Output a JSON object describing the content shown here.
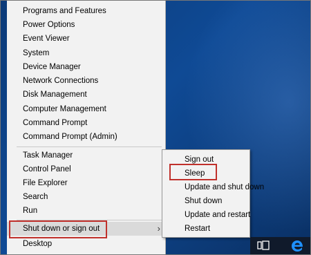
{
  "power_user_menu": {
    "group1": [
      "Programs and Features",
      "Power Options",
      "Event Viewer",
      "System",
      "Device Manager",
      "Network Connections",
      "Disk Management",
      "Computer Management",
      "Command Prompt",
      "Command Prompt (Admin)"
    ],
    "group2": [
      "Task Manager",
      "Control Panel",
      "File Explorer",
      "Search",
      "Run"
    ],
    "shutdown_item": "Shut down or sign out",
    "desktop_item": "Desktop"
  },
  "shutdown_submenu": {
    "items": [
      "Sign out",
      "Sleep",
      "Update and shut down",
      "Shut down",
      "Update and restart",
      "Restart"
    ]
  },
  "highlight_color": "#c0302b",
  "taskbar": {
    "icons": [
      "task-view-icon",
      "edge-icon"
    ]
  }
}
